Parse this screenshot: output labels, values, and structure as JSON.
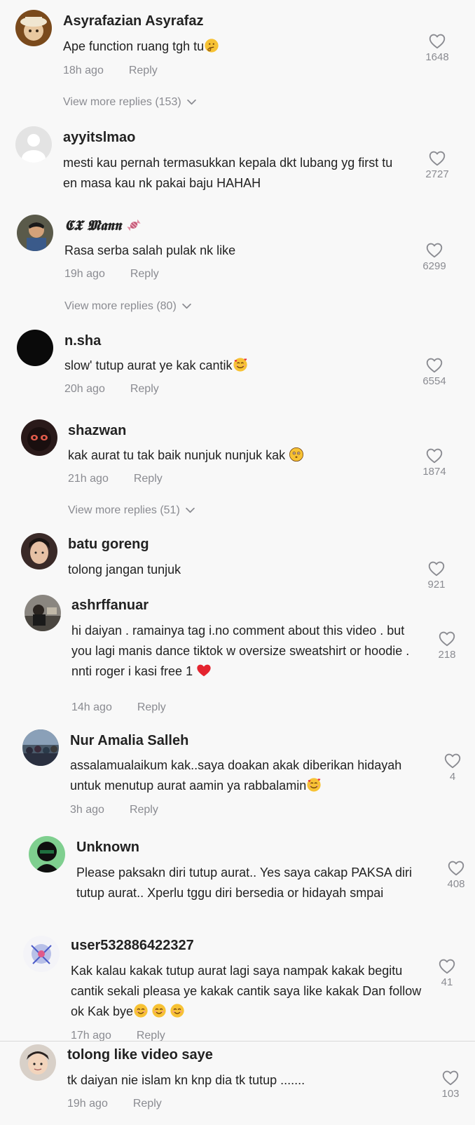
{
  "reply_label": "Reply",
  "comments": [
    {
      "username": "Asyrafazian Asyrafaz",
      "text": "Ape function ruang tgh tu",
      "time": "18h ago",
      "likes": "1648",
      "more": "View more replies (153)"
    },
    {
      "username": "ayyitslmao",
      "text": "mesti kau pernah termasukkan kepala dkt lubang yg first tu en masa kau nk pakai baju HAHAH",
      "likes": "2727"
    },
    {
      "username": "𝕮𝖃 𝕸𝖆𝖓𝖓",
      "text": "Rasa serba salah pulak nk like",
      "time": "19h ago",
      "likes": "6299",
      "more": "View more replies (80)"
    },
    {
      "username": "n.sha",
      "text": "slow' tutup aurat ye kak cantik",
      "time": "20h ago",
      "likes": "6554"
    },
    {
      "username": "shazwan",
      "text": "kak aurat tu tak baik nunjuk nunjuk kak",
      "time": "21h ago",
      "likes": "1874",
      "more": "View more replies (51)"
    },
    {
      "username": "batu goreng",
      "text": "tolong jangan tunjuk",
      "likes": "921"
    },
    {
      "username": "ashrffanuar",
      "text": "hi daiyan . ramainya tag i.no comment about this video . but you lagi manis dance tiktok w oversize sweatshirt or hoodie . nnti roger i kasi free 1",
      "time": "14h ago",
      "likes": "218"
    },
    {
      "username": "Nur Amalia Salleh",
      "text": "assalamualaikum kak..saya doakan akak diberikan hidayah untuk menutup aurat aamin ya rabbalamin",
      "time": "3h ago",
      "likes": "4"
    },
    {
      "username": "Unknown",
      "text": "Please paksakn diri tutup aurat.. Yes saya cakap PAKSA diri tutup aurat.. Xperlu tggu diri bersedia or hidayah smpai",
      "likes": "408"
    },
    {
      "username": "user532886422327",
      "text": "Kak kalau kakak tutup aurat lagi saya nampak kakak begitu cantik sekali pleasa ye kakak cantik saya like kakak Dan follow ok Kak bye",
      "time": "17h ago",
      "likes": "41"
    },
    {
      "username": "tolong like video saye",
      "text": "tk daiyan nie islam kn knp dia tk tutup .......",
      "time": "19h ago",
      "likes": "103"
    }
  ]
}
